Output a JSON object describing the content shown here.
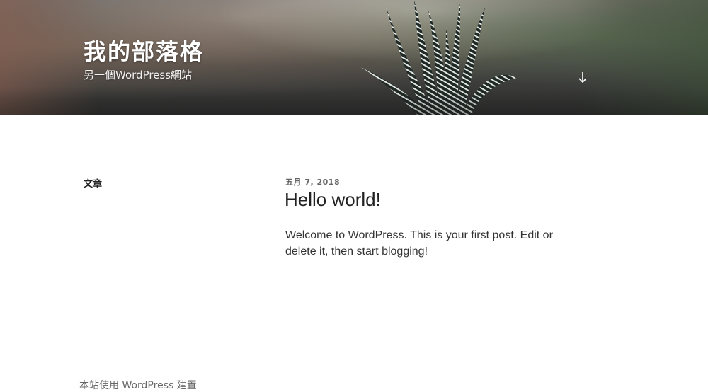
{
  "header": {
    "site_title": "我的部落格",
    "site_description": "另一個WordPress網站",
    "scroll_icon": "arrow-down-icon",
    "image_subject": "succulent-plant"
  },
  "sidebar": {
    "heading": "文章"
  },
  "post": {
    "date": "五月 7, 2018",
    "title": "Hello world!",
    "excerpt": "Welcome to WordPress. This is your first post. Edit or delete it, then start blogging!"
  },
  "footer": {
    "credit": "本站使用 WordPress 建置"
  },
  "colors": {
    "header_text": "#ffffff",
    "body_text": "#222222",
    "muted_text": "#666666",
    "divider": "#eeeeee"
  }
}
